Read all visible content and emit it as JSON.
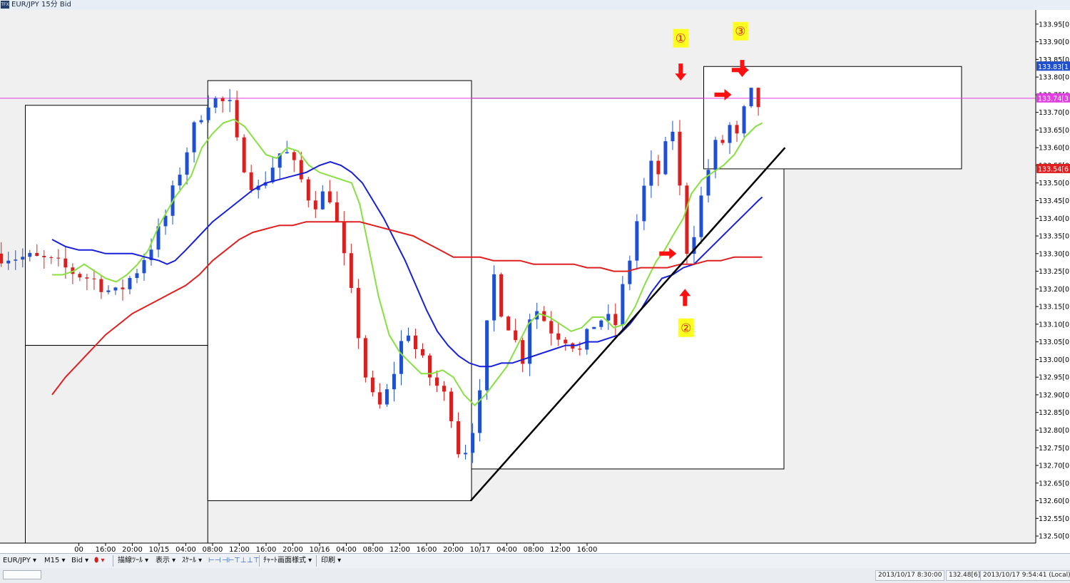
{
  "window": {
    "title": "EUR/JPY 15分 Bid",
    "logo_text": "TFX"
  },
  "chart_data": {
    "type": "candlestick",
    "instrument": "EUR/JPY",
    "timeframe": "15分",
    "price_type": "Bid",
    "ylim": [
      132.48,
      133.99
    ],
    "y_ticks": [
      "133.95[0]",
      "133.90[0]",
      "133.85[0]",
      "133.80[0]",
      "133.75[0]",
      "133.70[0]",
      "133.65[0]",
      "133.60[0]",
      "133.55[0]",
      "133.50[0]",
      "133.45[0]",
      "133.40[0]",
      "133.35[0]",
      "133.30[0]",
      "133.25[0]",
      "133.20[0]",
      "133.15[0]",
      "133.10[0]",
      "133.05[0]",
      "133.00[0]",
      "132.95[0]",
      "132.90[0]",
      "132.85[0]",
      "132.80[0]",
      "132.75[0]",
      "132.70[0]",
      "132.65[0]",
      "132.60[0]",
      "132.55[0]",
      "132.50[0]"
    ],
    "x_ticks": [
      "00",
      "16:00",
      "20:00",
      "10/15",
      "04:00",
      "08:00",
      "12:00",
      "16:00",
      "20:00",
      "10/16",
      "04:00",
      "08:00",
      "12:00",
      "16:00",
      "20:00",
      "10/17",
      "04:00",
      "08:00",
      "12:00",
      "16:00"
    ],
    "price_labels": [
      {
        "text": "133.83[1",
        "value": 133.83,
        "color": "#2050d0"
      },
      {
        "text": "133.74[3",
        "value": 133.74,
        "color": "#e040e0"
      },
      {
        "text": "133.54[6",
        "value": 133.54,
        "color": "#e02020"
      }
    ],
    "horizontal_line": {
      "value": 133.74,
      "color": "#e040e0"
    },
    "moving_averages": [
      {
        "color": "#88e040",
        "points": [
          [
            -4,
            133.24
          ],
          [
            -3.6,
            133.24
          ],
          [
            -3.2,
            133.25
          ],
          [
            -2.8,
            133.27
          ],
          [
            -2.4,
            133.25
          ],
          [
            -2,
            133.23
          ],
          [
            -1.6,
            133.22
          ],
          [
            -1.2,
            133.24
          ],
          [
            -0.8,
            133.27
          ],
          [
            -0.4,
            133.31
          ],
          [
            0,
            133.38
          ],
          [
            0.6,
            133.46
          ],
          [
            1.2,
            133.52
          ],
          [
            1.6,
            133.6
          ],
          [
            2,
            133.64
          ],
          [
            2.4,
            133.67
          ],
          [
            2.8,
            133.68
          ],
          [
            3.2,
            133.66
          ],
          [
            3.6,
            133.62
          ],
          [
            4,
            133.58
          ],
          [
            4.4,
            133.57
          ],
          [
            4.8,
            133.6
          ],
          [
            5.2,
            133.59
          ],
          [
            5.6,
            133.55
          ],
          [
            6,
            133.53
          ],
          [
            6.4,
            133.52
          ],
          [
            6.8,
            133.51
          ],
          [
            7.2,
            133.5
          ],
          [
            7.5,
            133.44
          ],
          [
            7.8,
            133.33
          ],
          [
            8.2,
            133.18
          ],
          [
            8.6,
            133.07
          ],
          [
            9,
            133.02
          ],
          [
            9.4,
            132.99
          ],
          [
            9.8,
            132.96
          ],
          [
            10.2,
            132.96
          ],
          [
            10.6,
            132.97
          ],
          [
            11,
            132.95
          ],
          [
            11.4,
            132.9
          ],
          [
            11.8,
            132.87
          ],
          [
            12.2,
            132.9
          ],
          [
            12.6,
            132.94
          ],
          [
            13,
            132.98
          ],
          [
            13.4,
            133.04
          ],
          [
            13.8,
            133.1
          ],
          [
            14.2,
            133.13
          ],
          [
            14.6,
            133.12
          ],
          [
            15,
            133.1
          ],
          [
            15.4,
            133.08
          ],
          [
            15.8,
            133.09
          ],
          [
            16.2,
            133.12
          ],
          [
            16.6,
            133.12
          ],
          [
            17,
            133.09
          ],
          [
            17.4,
            133.1
          ],
          [
            17.8,
            133.15
          ],
          [
            18.2,
            133.22
          ],
          [
            18.6,
            133.28
          ],
          [
            18.9,
            133.31
          ],
          [
            19.2,
            133.35
          ],
          [
            19.6,
            133.4
          ],
          [
            19.9,
            133.47
          ],
          [
            20.3,
            133.51
          ],
          [
            20.7,
            133.53
          ],
          [
            21.1,
            133.55
          ],
          [
            21.5,
            133.58
          ],
          [
            21.9,
            133.63
          ],
          [
            22.3,
            133.66
          ],
          [
            22.55,
            133.67
          ]
        ]
      },
      {
        "color": "#1820d8",
        "points": [
          [
            -4,
            133.34
          ],
          [
            -3.5,
            133.32
          ],
          [
            -3,
            133.31
          ],
          [
            -2.5,
            133.31
          ],
          [
            -2,
            133.3
          ],
          [
            -1.5,
            133.3
          ],
          [
            -1,
            133.3
          ],
          [
            -0.5,
            133.29
          ],
          [
            0,
            133.28
          ],
          [
            0.3,
            133.27
          ],
          [
            0.6,
            133.28
          ],
          [
            1,
            133.31
          ],
          [
            1.5,
            133.35
          ],
          [
            2,
            133.39
          ],
          [
            2.5,
            133.42
          ],
          [
            3,
            133.45
          ],
          [
            3.5,
            133.48
          ],
          [
            4,
            133.5
          ],
          [
            4.5,
            133.51
          ],
          [
            5,
            133.52
          ],
          [
            5.5,
            133.53
          ],
          [
            6,
            133.55
          ],
          [
            6.4,
            133.56
          ],
          [
            6.8,
            133.55
          ],
          [
            7.2,
            133.53
          ],
          [
            7.6,
            133.5
          ],
          [
            8,
            133.45
          ],
          [
            8.4,
            133.4
          ],
          [
            8.8,
            133.34
          ],
          [
            9.2,
            133.28
          ],
          [
            9.6,
            133.21
          ],
          [
            10,
            133.14
          ],
          [
            10.4,
            133.08
          ],
          [
            10.8,
            133.04
          ],
          [
            11.2,
            133.01
          ],
          [
            11.6,
            132.99
          ],
          [
            12,
            132.98
          ],
          [
            12.4,
            132.98
          ],
          [
            12.8,
            132.99
          ],
          [
            13.2,
            132.99
          ],
          [
            13.6,
            133
          ],
          [
            14,
            133.01
          ],
          [
            14.4,
            133.02
          ],
          [
            14.8,
            133.03
          ],
          [
            15.2,
            133.04
          ],
          [
            15.6,
            133.04
          ],
          [
            16,
            133.05
          ],
          [
            16.4,
            133.05
          ],
          [
            16.8,
            133.06
          ],
          [
            17.2,
            133.07
          ],
          [
            17.6,
            133.1
          ],
          [
            18,
            133.14
          ],
          [
            18.4,
            133.19
          ],
          [
            18.8,
            133.23
          ],
          [
            19.2,
            133.24
          ],
          [
            19.6,
            133.26
          ],
          [
            20,
            133.27
          ],
          [
            20.4,
            133.3
          ],
          [
            20.8,
            133.33
          ],
          [
            21.2,
            133.36
          ],
          [
            21.6,
            133.39
          ],
          [
            22,
            133.42
          ],
          [
            22.4,
            133.45
          ],
          [
            22.55,
            133.46
          ]
        ]
      },
      {
        "color": "#e02020",
        "points": [
          [
            -4,
            132.9
          ],
          [
            -3.5,
            132.95
          ],
          [
            -3,
            132.99
          ],
          [
            -2.5,
            133.03
          ],
          [
            -2,
            133.07
          ],
          [
            -1.5,
            133.1
          ],
          [
            -1,
            133.13
          ],
          [
            -0.5,
            133.15
          ],
          [
            0,
            133.17
          ],
          [
            0.5,
            133.19
          ],
          [
            1,
            133.21
          ],
          [
            1.5,
            133.24
          ],
          [
            2,
            133.28
          ],
          [
            2.5,
            133.31
          ],
          [
            3,
            133.34
          ],
          [
            3.5,
            133.36
          ],
          [
            4,
            133.37
          ],
          [
            4.5,
            133.38
          ],
          [
            5,
            133.38
          ],
          [
            5.5,
            133.39
          ],
          [
            6,
            133.39
          ],
          [
            6.5,
            133.39
          ],
          [
            7,
            133.39
          ],
          [
            7.5,
            133.39
          ],
          [
            8,
            133.38
          ],
          [
            8.5,
            133.37
          ],
          [
            9,
            133.36
          ],
          [
            9.5,
            133.35
          ],
          [
            10,
            133.33
          ],
          [
            10.5,
            133.31
          ],
          [
            11,
            133.29
          ],
          [
            11.5,
            133.29
          ],
          [
            12,
            133.29
          ],
          [
            12.5,
            133.28
          ],
          [
            13,
            133.28
          ],
          [
            13.5,
            133.28
          ],
          [
            14,
            133.27
          ],
          [
            14.5,
            133.27
          ],
          [
            15,
            133.27
          ],
          [
            15.5,
            133.27
          ],
          [
            16,
            133.26
          ],
          [
            16.5,
            133.26
          ],
          [
            17,
            133.25
          ],
          [
            17.5,
            133.25
          ],
          [
            18,
            133.26
          ],
          [
            18.5,
            133.26
          ],
          [
            19,
            133.26
          ],
          [
            19.5,
            133.27
          ],
          [
            20,
            133.27
          ],
          [
            20.5,
            133.28
          ],
          [
            21,
            133.28
          ],
          [
            21.5,
            133.29
          ],
          [
            22,
            133.29
          ],
          [
            22.55,
            133.29
          ]
        ]
      }
    ],
    "trendline": {
      "color": "#000000",
      "points": [
        [
          11.65,
          132.6
        ],
        [
          23.4,
          133.6
        ]
      ]
    },
    "rectangles": [
      {
        "x1": -5,
        "x2": 1.82,
        "y1": 133.72,
        "y2": 133.04,
        "fill": "#ffffff",
        "stroke": "#000000"
      },
      {
        "x1": -5,
        "x2": 1.82,
        "y1": 133.04,
        "y2": 132.48,
        "fill": "#f0f0f0",
        "stroke": "#000000"
      },
      {
        "x1": 1.82,
        "x2": 11.68,
        "y1": 133.79,
        "y2": 132.6,
        "fill": "#ffffff",
        "stroke": "#000000"
      },
      {
        "x1": 11.68,
        "x2": 23.36,
        "y1": 133.74,
        "y2": 132.69,
        "fill": "#ffffff",
        "stroke": "#000000"
      },
      {
        "x1": 20.36,
        "x2": 30,
        "y1": 133.83,
        "y2": 133.54,
        "fill": "#ffffff",
        "stroke": "#000000"
      }
    ],
    "annotations": [
      {
        "label": "①",
        "x": 19.5,
        "value": 133.91,
        "arrow": "down",
        "ax": 19.5,
        "av": 133.79
      },
      {
        "label": "②",
        "x": 19.7,
        "value": 133.09,
        "arrow": "up",
        "ax": 19.66,
        "av": 133.2
      },
      {
        "label": "③",
        "x": 21.73,
        "value": 133.93,
        "arrow": "none"
      },
      {
        "label": "",
        "arrow": "right",
        "ax": 19.34,
        "av": 133.3
      },
      {
        "label": "",
        "arrow": "right",
        "ax": 21.4,
        "av": 133.75
      },
      {
        "label": "",
        "arrow": "down",
        "ax": 21.8,
        "av": 133.8
      },
      {
        "label": "",
        "arrow": "right",
        "ax": 22.05,
        "av": 133.82
      }
    ],
    "grid": false
  },
  "toolbar": {
    "symbol": "EUR/JPY",
    "timeframe": "M15",
    "price": "Bid",
    "drawing_tools": "描線ﾂｰﾙ",
    "display": "表示",
    "scale": "ｽｹｰﾙ",
    "chart_style": "ﾁｬｰﾄ画面様式",
    "print": "印刷"
  },
  "statusbar": {
    "cursor_time": "2013/10/17 8:30:00",
    "cursor_price": "132.48[6]",
    "local_time": "2013/10/17 9:54:41 (Local)"
  },
  "colors": {
    "bull": "#2050d0",
    "bear": "#d82020",
    "axis_bg": "#ffffff",
    "plot_bg": "#f0f0f0"
  }
}
